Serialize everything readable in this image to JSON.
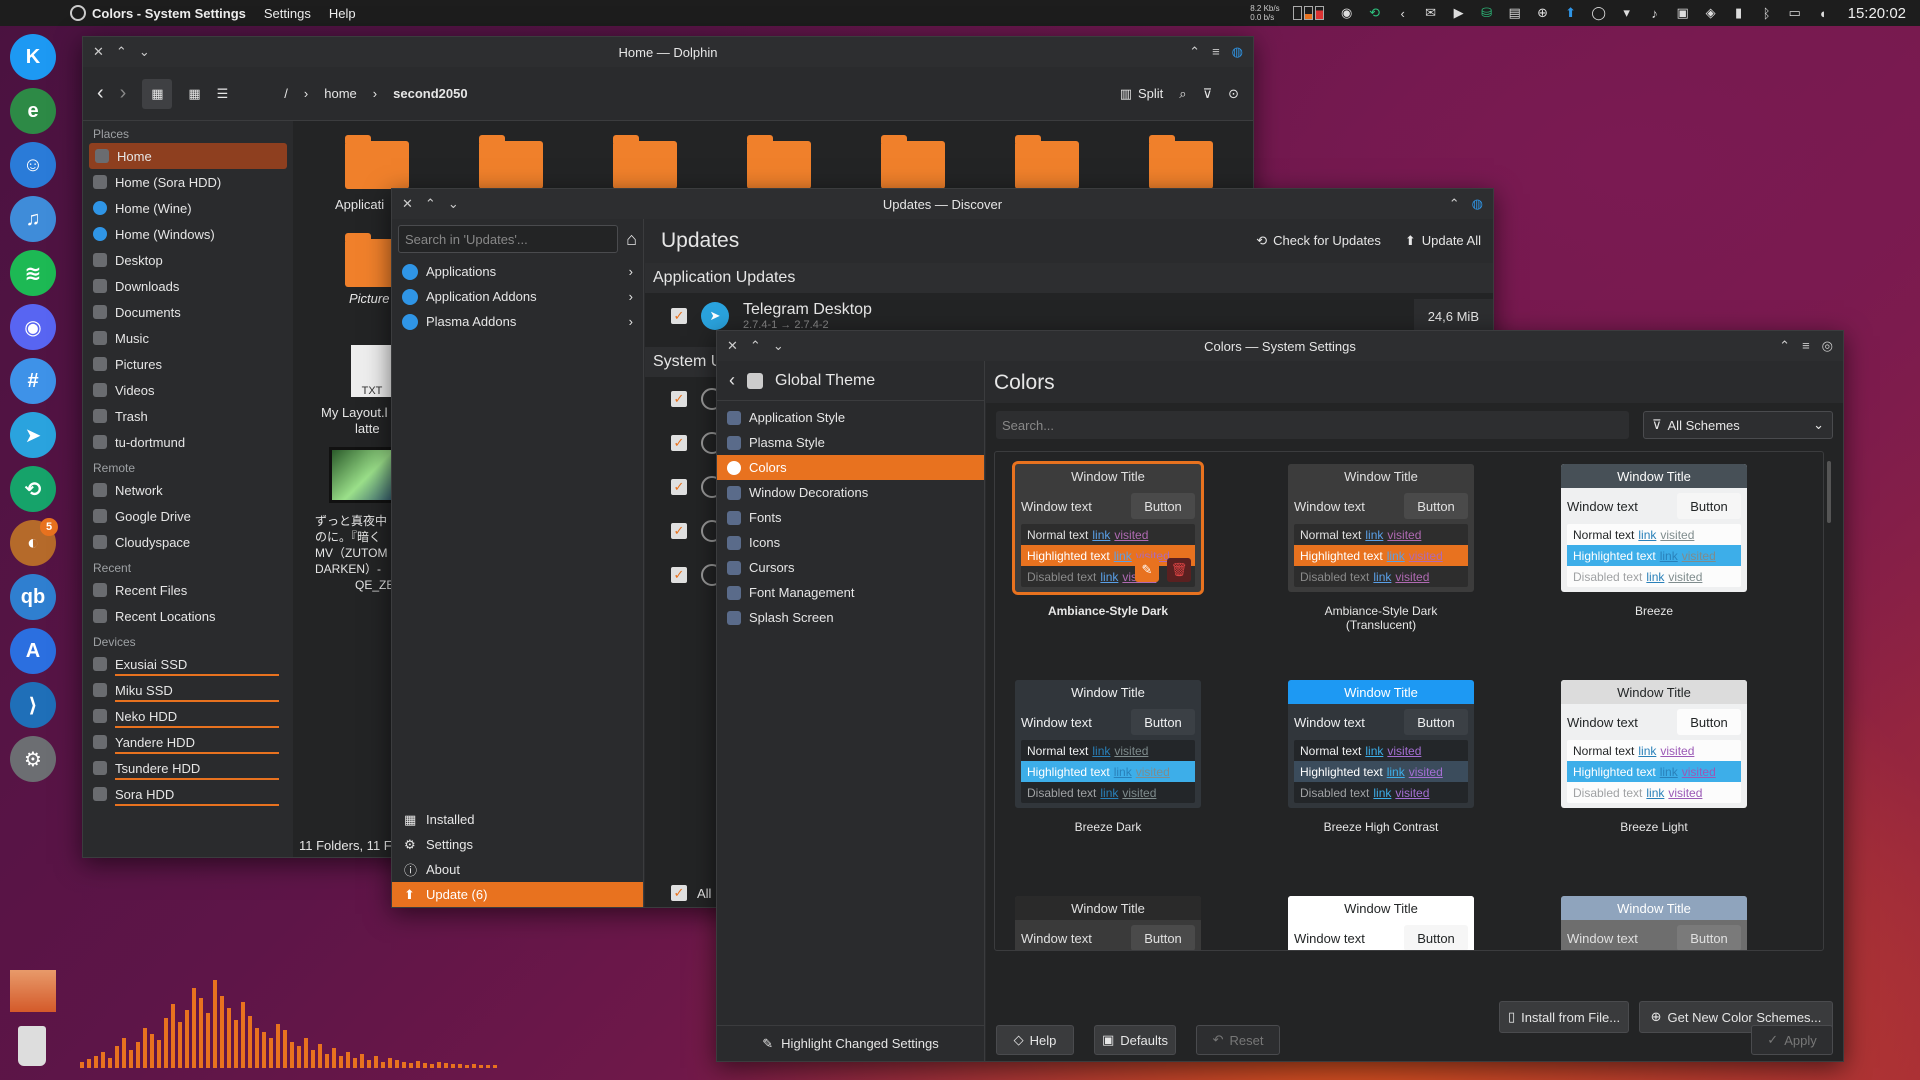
{
  "topbar": {
    "app_title": "Colors  - System Settings",
    "menu": [
      "Settings",
      "Help"
    ],
    "net_up": "8.2 Kb/s",
    "net_down": "0.0 b/s",
    "clock": "15:20:02"
  },
  "dock": {
    "items": [
      {
        "name": "kde-icon",
        "color": "#1d99f3",
        "glyph": "K"
      },
      {
        "name": "edge-dev-icon",
        "color": "#2d8a46",
        "glyph": "e"
      },
      {
        "name": "finder-icon",
        "color": "#2a7bd8",
        "glyph": "☺"
      },
      {
        "name": "music-icon",
        "color": "#3f8cd9",
        "glyph": "♫"
      },
      {
        "name": "spotify-icon",
        "color": "#1db954",
        "glyph": "≋"
      },
      {
        "name": "discord-icon",
        "color": "#5865f2",
        "glyph": "◉"
      },
      {
        "name": "chat-hash-icon",
        "color": "#3e92e8",
        "glyph": "#"
      },
      {
        "name": "telegram-icon",
        "color": "#2aa3de",
        "glyph": "➤"
      },
      {
        "name": "sync-icon",
        "color": "#16a36a",
        "glyph": "⟲"
      },
      {
        "name": "app-badge-icon",
        "color": "#b56a2a",
        "glyph": "◐",
        "badge": "5"
      },
      {
        "name": "qbittorrent-icon",
        "color": "#2f7fd0",
        "glyph": "qb"
      },
      {
        "name": "app-store-icon",
        "color": "#2b6fe0",
        "glyph": "A"
      },
      {
        "name": "vscode-icon",
        "color": "#1f6fb8",
        "glyph": "⟩"
      },
      {
        "name": "settings-icon",
        "color": "#6c6e72",
        "glyph": "⚙"
      }
    ]
  },
  "dolphin": {
    "title": "Home — Dolphin",
    "path": [
      "/",
      "home",
      "second2050"
    ],
    "split_label": "Split",
    "places_heading": "Places",
    "places": [
      "Home",
      "Home (Sora HDD)",
      "Home (Wine)",
      "Home (Windows)",
      "Desktop",
      "Downloads",
      "Documents",
      "Music",
      "Pictures",
      "Videos",
      "Trash",
      "tu-dortmund"
    ],
    "remote_heading": "Remote",
    "remote": [
      "Network",
      "Google Drive",
      "Cloudyspace"
    ],
    "recent_heading": "Recent",
    "recent": [
      "Recent Files",
      "Recent Locations"
    ],
    "devices_heading": "Devices",
    "devices": [
      "Exusiai SSD",
      "Miku SSD",
      "Neko HDD",
      "Yandere HDD",
      "Tsundere HDD",
      "Sora HDD"
    ],
    "files": {
      "applications": "Applicati",
      "pictures": "Picture",
      "txt_ext": "TXT",
      "layout": "My Layout.l",
      "layout2": "latte",
      "video1": "ずっと真夜中",
      "video2": "のに。『暗く",
      "video3": "MV（ZUTOM",
      "video4": "DARKEN）-",
      "video5": "QE_ZE.m"
    },
    "status": "11 Folders, 11 F"
  },
  "discover": {
    "title": "Updates — Discover",
    "search_placeholder": "Search in 'Updates'...",
    "nav": [
      "Applications",
      "Application Addons",
      "Plasma Addons"
    ],
    "bottom_nav": [
      "Installed",
      "Settings",
      "About",
      "Update (6)"
    ],
    "page_title": "Updates",
    "check_label": "Check for Updates",
    "update_all_label": "Update All",
    "app_updates_heading": "Application Updates",
    "telegram_name": "Telegram Desktop",
    "telegram_version": "2.7.4-1 → 2.7.4-2",
    "telegram_size": "24,6 MiB",
    "system_heading": "System U",
    "all_label": "All"
  },
  "settings": {
    "title": "Colors — System Settings",
    "back_section": "Global Theme",
    "nav": [
      "Application Style",
      "Plasma Style",
      "Colors",
      "Window Decorations",
      "Fonts",
      "Icons",
      "Cursors",
      "Font Management",
      "Splash Screen"
    ],
    "page_title": "Colors",
    "search_placeholder": "Search...",
    "filter": "All Schemes",
    "highlight_changed": "Highlight Changed Settings",
    "install_file": "Install from File...",
    "get_new": "Get New Color Schemes...",
    "help": "Help",
    "defaults": "Defaults",
    "reset": "Reset",
    "apply": "Apply",
    "preview": {
      "window_title": "Window Title",
      "window_text": "Window text",
      "button": "Button",
      "normal": "Normal text",
      "highlighted": "Highlighted text",
      "disabled": "Disabled text",
      "link": "link",
      "visited": "visited"
    },
    "schemes": [
      {
        "name": "Ambiance-Style Dark",
        "selected": true,
        "tb": "#3c3c3c",
        "tbfg": "#e0e0e0",
        "win": "#3c3c3c",
        "wfg": "#e0e0e0",
        "btn": "#4a4a4a",
        "view": "#2d2d2d",
        "vfg": "#e0e0e0",
        "hl": "#e8721f",
        "link": "#5aa0e8",
        "vis": "#b06ab3",
        "dis": "#8a8a8a"
      },
      {
        "name": "Ambiance-Style Dark (Translucent)",
        "tb": "#3c3c3c",
        "tbfg": "#e0e0e0",
        "win": "#3c3c3c",
        "wfg": "#e0e0e0",
        "btn": "#4a4a4a",
        "view": "#2d2d2d",
        "vfg": "#e0e0e0",
        "hl": "#e8721f",
        "link": "#5aa0e8",
        "vis": "#b06ab3",
        "dis": "#8a8a8a"
      },
      {
        "name": "Breeze",
        "tb": "#475057",
        "tbfg": "#fcfcfc",
        "win": "#eff0f1",
        "wfg": "#232627",
        "btn": "#f6f6f6",
        "view": "#fcfcfc",
        "vfg": "#232627",
        "hl": "#3daee9",
        "link": "#2980b9",
        "vis": "#7f8c8d",
        "dis": "#a0a2a4"
      },
      {
        "name": "Breeze Dark",
        "tb": "#31363b",
        "tbfg": "#eff0f1",
        "win": "#31363b",
        "wfg": "#eff0f1",
        "btn": "#3b4045",
        "view": "#232629",
        "vfg": "#eff0f1",
        "hl": "#3daee9",
        "link": "#2980b9",
        "vis": "#7f8c8d",
        "dis": "#a0a2a4"
      },
      {
        "name": "Breeze High Contrast",
        "tb": "#1d99f3",
        "tbfg": "#ffffff",
        "win": "#31363b",
        "wfg": "#eff0f1",
        "btn": "#3b4045",
        "view": "#232629",
        "vfg": "#eff0f1",
        "hl": "#3b4c5c",
        "link": "#3daee9",
        "vis": "#a56fd4",
        "dis": "#a0a2a4"
      },
      {
        "name": "Breeze Light",
        "tb": "#dcdcdc",
        "tbfg": "#232627",
        "win": "#eff0f1",
        "wfg": "#232627",
        "btn": "#fcfcfc",
        "view": "#fcfcfc",
        "vfg": "#232627",
        "hl": "#3daee9",
        "link": "#2980b9",
        "vis": "#9b59b6",
        "dis": "#a0a2a4"
      },
      {
        "name": "",
        "tb": "#2a2a2a",
        "tbfg": "#e0e0e0",
        "win": "#3a3a3a",
        "wfg": "#e0e0e0",
        "btn": "#4a4a4a",
        "view": "#2d2d2d",
        "vfg": "#e0e0e0",
        "hl": "#e8721f",
        "link": "#5aa0e8",
        "vis": "#b06ab3",
        "dis": "#8a8a8a"
      },
      {
        "name": "",
        "tb": "#ffffff",
        "tbfg": "#232627",
        "win": "#ffffff",
        "wfg": "#232627",
        "btn": "#f6f6f6",
        "view": "#ffffff",
        "vfg": "#232627",
        "hl": "#3daee9",
        "link": "#2980b9",
        "vis": "#9b59b6",
        "dis": "#a0a2a4"
      },
      {
        "name": "",
        "tb": "#8fa4bd",
        "tbfg": "#ffffff",
        "win": "#6e6e6e",
        "wfg": "#e0e0e0",
        "btn": "#7a7a7a",
        "view": "#5a5a5a",
        "vfg": "#e0e0e0",
        "hl": "#3daee9",
        "link": "#2980b9",
        "vis": "#9b59b6",
        "dis": "#a0a2a4"
      }
    ]
  },
  "visualizer": {
    "levels": [
      6,
      9,
      12,
      16,
      10,
      22,
      30,
      18,
      26,
      40,
      34,
      28,
      50,
      64,
      46,
      58,
      80,
      70,
      55,
      88,
      72,
      60,
      48,
      66,
      52,
      40,
      36,
      30,
      44,
      38,
      26,
      22,
      30,
      18,
      24,
      14,
      20,
      12,
      16,
      10,
      14,
      8,
      12,
      6,
      10,
      8,
      6,
      5,
      7,
      5,
      4,
      6,
      5,
      4,
      4,
      3,
      4,
      3,
      3,
      3
    ],
    "color": "#e8721f"
  },
  "colors": {
    "accent": "#e8721f",
    "panel": "#1d1d1d"
  }
}
